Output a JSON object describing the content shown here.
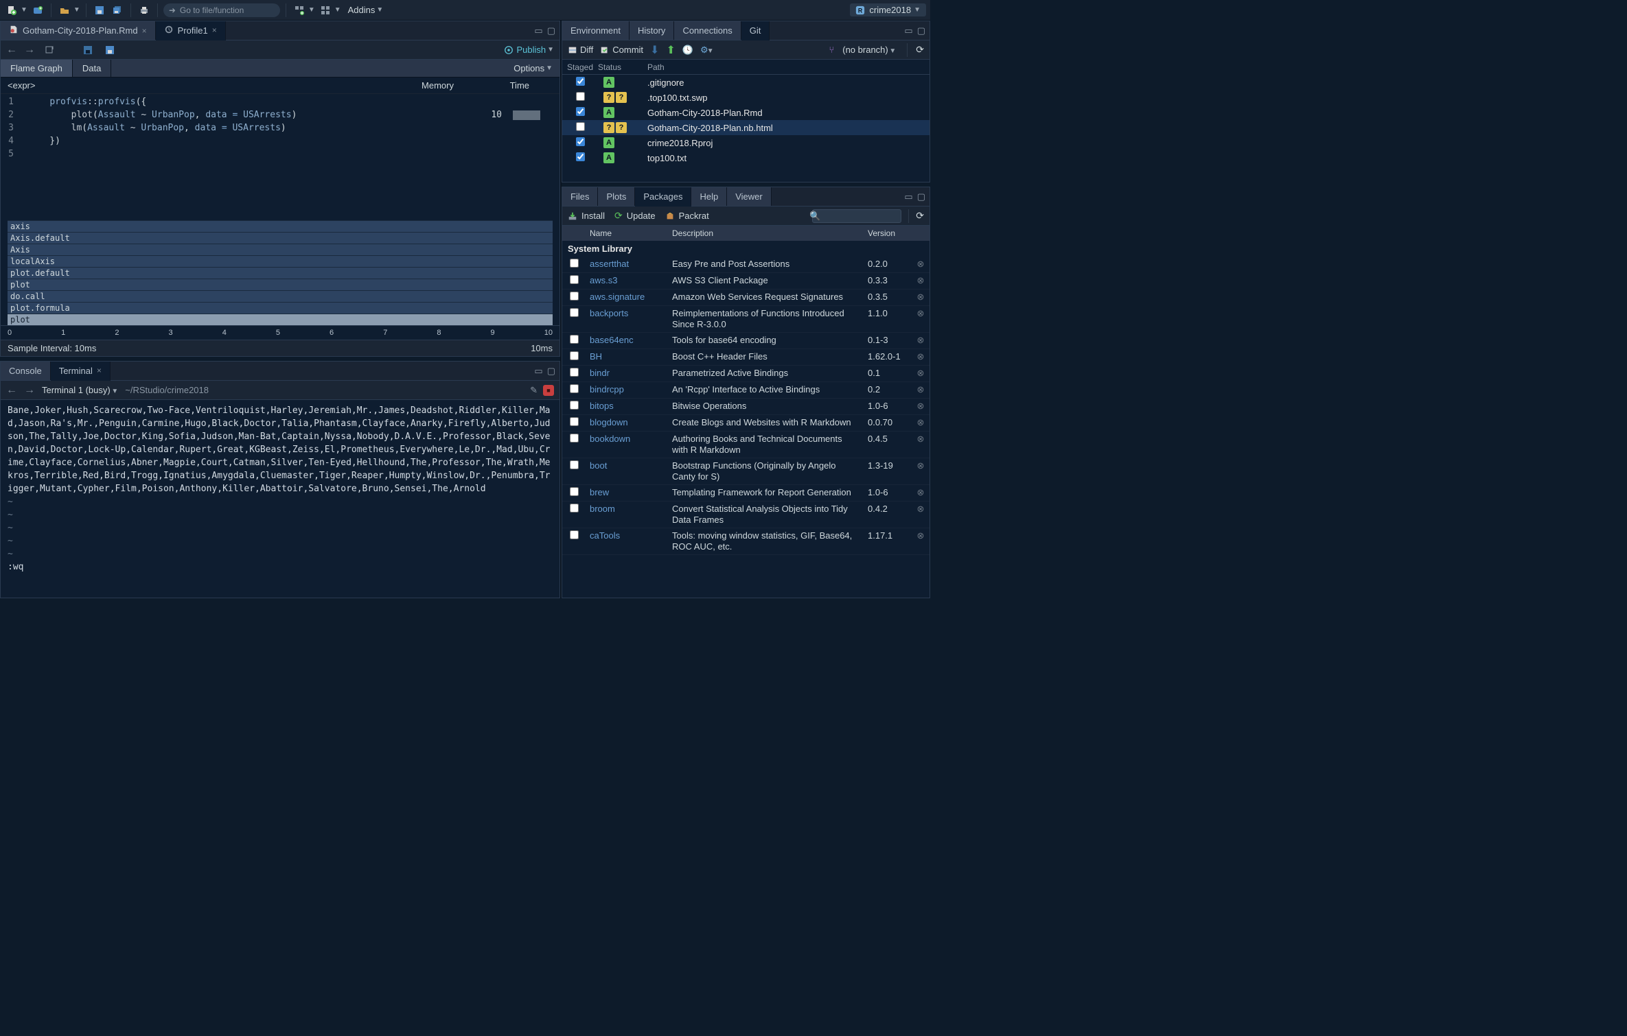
{
  "project_name": "crime2018",
  "toolbar": {
    "goto_placeholder": "Go to file/function",
    "addins": "Addins"
  },
  "editor_tabs": [
    {
      "label": "Gotham-City-2018-Plan.Rmd",
      "active": false
    },
    {
      "label": "Profile1",
      "active": true
    }
  ],
  "publish": "Publish",
  "profile_subtabs": {
    "flame": "Flame Graph",
    "data": "Data",
    "options": "Options"
  },
  "prof_header": {
    "expr": "<expr>",
    "memory": "Memory",
    "time": "Time"
  },
  "code": [
    {
      "n": "1",
      "text": "    profvis::profvis({"
    },
    {
      "n": "2",
      "text": "        plot(Assault ~ UrbanPop, data = USArrests)",
      "time": "10",
      "bar": true
    },
    {
      "n": "3",
      "text": "        lm(Assault ~ UrbanPop, data = USArrests)"
    },
    {
      "n": "4",
      "text": "    })"
    },
    {
      "n": "5",
      "text": ""
    }
  ],
  "flame_rows": [
    "axis",
    "Axis.default",
    "Axis",
    "localAxis",
    "plot.default",
    "plot",
    "do.call",
    "plot.formula",
    "plot"
  ],
  "axis_ticks": [
    "0",
    "1",
    "2",
    "3",
    "4",
    "5",
    "6",
    "7",
    "8",
    "9",
    "10"
  ],
  "interval": {
    "label": "Sample Interval: 10ms",
    "right": "10ms"
  },
  "console_tabs": {
    "console": "Console",
    "terminal": "Terminal"
  },
  "terminal": {
    "name": "Terminal 1 (busy)",
    "path": "~/RStudio/crime2018",
    "body": "Bane,Joker,Hush,Scarecrow,Two-Face,Ventriloquist,Harley,Jeremiah,Mr.,James,Deadshot,Riddler,Killer,Mad,Jason,Ra's,Mr.,Penguin,Carmine,Hugo,Black,Doctor,Talia,Phantasm,Clayface,Anarky,Firefly,Alberto,Judson,The,Tally,Joe,Doctor,King,Sofia,Judson,Man-Bat,Captain,Nyssa,Nobody,D.A.V.E.,Professor,Black,Seven,David,Doctor,Lock-Up,Calendar,Rupert,Great,KGBeast,Zeiss,El,Prometheus,Everywhere,Le,Dr.,Mad,Ubu,Crime,Clayface,Cornelius,Abner,Magpie,Court,Catman,Silver,Ten-Eyed,Hellhound,The,Professor,The,Wrath,Mekros,Terrible,Red,Bird,Trogg,Ignatius,Amygdala,Cluemaster,Tiger,Reaper,Humpty,Winslow,Dr.,Penumbra,Trigger,Mutant,Cypher,Film,Poison,Anthony,Killer,Abattoir,Salvatore,Bruno,Sensei,The,Arnold",
    "wq": ":wq"
  },
  "env_tabs": [
    "Environment",
    "History",
    "Connections",
    "Git"
  ],
  "git": {
    "diff": "Diff",
    "commit": "Commit",
    "branch": "(no branch)",
    "cols": {
      "staged": "Staged",
      "status": "Status",
      "path": "Path"
    },
    "rows": [
      {
        "staged": true,
        "status": [
          "A"
        ],
        "path": ".gitignore"
      },
      {
        "staged": false,
        "status": [
          "?",
          "?"
        ],
        "path": ".top100.txt.swp"
      },
      {
        "staged": true,
        "status": [
          "A"
        ],
        "path": "Gotham-City-2018-Plan.Rmd"
      },
      {
        "staged": false,
        "status": [
          "?",
          "?"
        ],
        "path": "Gotham-City-2018-Plan.nb.html",
        "sel": true
      },
      {
        "staged": true,
        "status": [
          "A"
        ],
        "path": "crime2018.Rproj"
      },
      {
        "staged": true,
        "status": [
          "A"
        ],
        "path": "top100.txt"
      }
    ]
  },
  "br_tabs": [
    "Files",
    "Plots",
    "Packages",
    "Help",
    "Viewer"
  ],
  "pkg_toolbar": {
    "install": "Install",
    "update": "Update",
    "packrat": "Packrat"
  },
  "pkg_head": {
    "name": "Name",
    "desc": "Description",
    "ver": "Version"
  },
  "pkg_section": "System Library",
  "packages": [
    {
      "name": "assertthat",
      "desc": "Easy Pre and Post Assertions",
      "ver": "0.2.0"
    },
    {
      "name": "aws.s3",
      "desc": "AWS S3 Client Package",
      "ver": "0.3.3"
    },
    {
      "name": "aws.signature",
      "desc": "Amazon Web Services Request Signatures",
      "ver": "0.3.5"
    },
    {
      "name": "backports",
      "desc": "Reimplementations of Functions Introduced Since R-3.0.0",
      "ver": "1.1.0"
    },
    {
      "name": "base64enc",
      "desc": "Tools for base64 encoding",
      "ver": "0.1-3"
    },
    {
      "name": "BH",
      "desc": "Boost C++ Header Files",
      "ver": "1.62.0-1"
    },
    {
      "name": "bindr",
      "desc": "Parametrized Active Bindings",
      "ver": "0.1"
    },
    {
      "name": "bindrcpp",
      "desc": "An 'Rcpp' Interface to Active Bindings",
      "ver": "0.2"
    },
    {
      "name": "bitops",
      "desc": "Bitwise Operations",
      "ver": "1.0-6"
    },
    {
      "name": "blogdown",
      "desc": "Create Blogs and Websites with R Markdown",
      "ver": "0.0.70"
    },
    {
      "name": "bookdown",
      "desc": "Authoring Books and Technical Documents with R Markdown",
      "ver": "0.4.5"
    },
    {
      "name": "boot",
      "desc": "Bootstrap Functions (Originally by Angelo Canty for S)",
      "ver": "1.3-19"
    },
    {
      "name": "brew",
      "desc": "Templating Framework for Report Generation",
      "ver": "1.0-6"
    },
    {
      "name": "broom",
      "desc": "Convert Statistical Analysis Objects into Tidy Data Frames",
      "ver": "0.4.2"
    },
    {
      "name": "caTools",
      "desc": "Tools: moving window statistics, GIF, Base64, ROC AUC, etc.",
      "ver": "1.17.1"
    }
  ]
}
